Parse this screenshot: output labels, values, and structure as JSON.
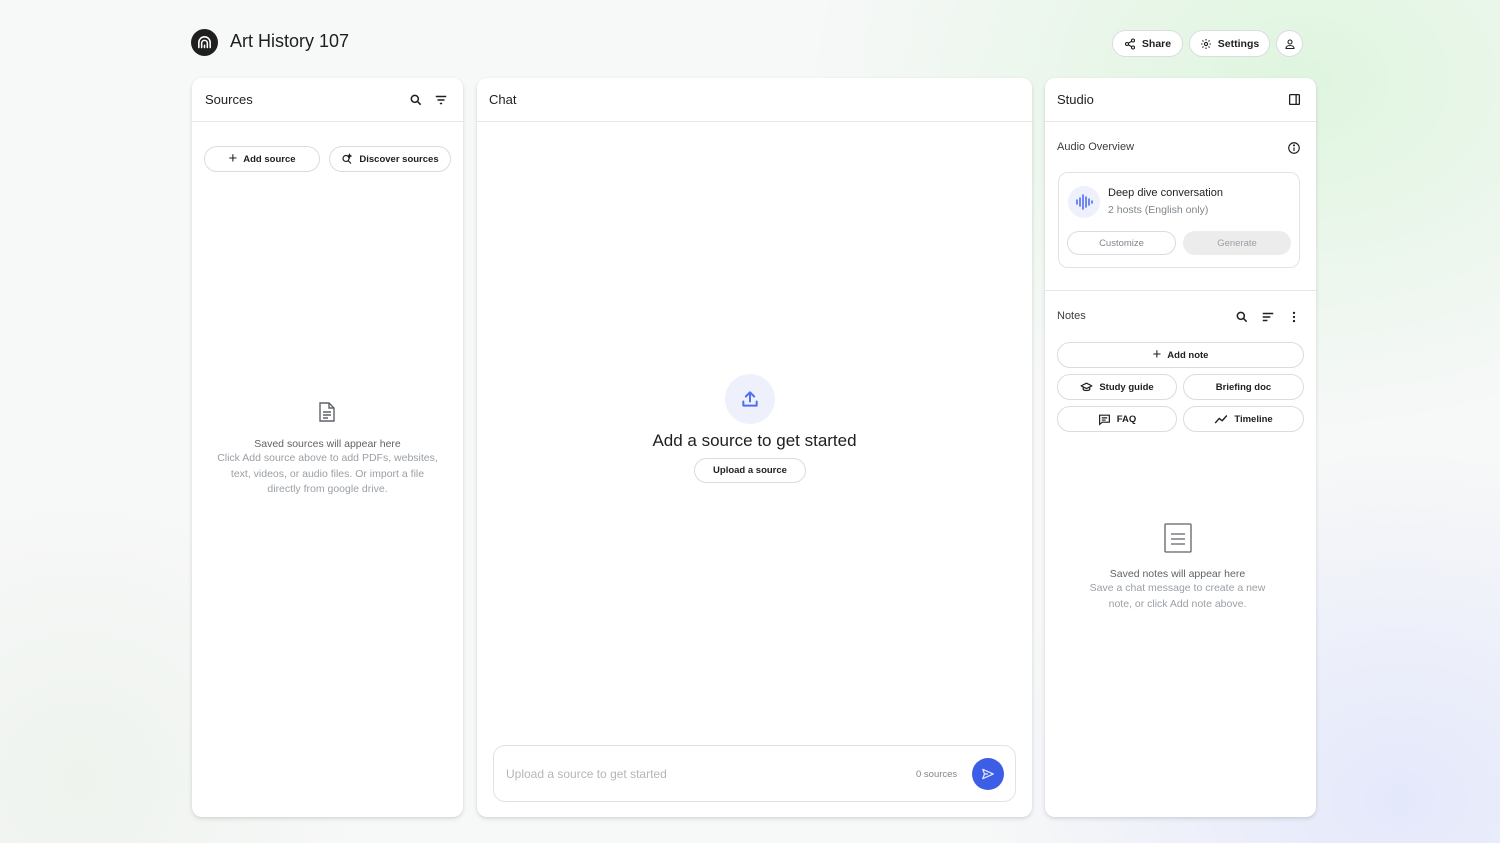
{
  "header": {
    "app_title": "Art History 107",
    "share_label": "Share",
    "settings_label": "Settings"
  },
  "sources": {
    "title": "Sources",
    "add_source_label": "Add source",
    "discover_sources_label": "Discover sources",
    "empty_title": "Saved sources will appear here",
    "empty_line1": "Click Add source above to add PDFs, websites,",
    "empty_line2": "text, videos, or audio files. Or import a file",
    "empty_line3": "directly from google drive."
  },
  "chat": {
    "title": "Chat",
    "cta_heading": "Add a source to get started",
    "upload_button_label": "Upload a source",
    "input_placeholder": "Upload a source to get started",
    "sources_count": "0 sources"
  },
  "studio": {
    "title": "Studio",
    "audio_overview_label": "Audio Overview",
    "audio_card_title": "Deep dive conversation",
    "audio_card_subtitle": "2 hosts (English only)",
    "customize_label": "Customize",
    "generate_label": "Generate",
    "notes_label": "Notes",
    "add_note_label": "Add note",
    "study_guide_label": "Study guide",
    "briefing_doc_label": "Briefing doc",
    "faq_label": "FAQ",
    "timeline_label": "Timeline",
    "notes_empty_title": "Saved notes will appear here",
    "notes_empty_line1": "Save a chat message to create a new",
    "notes_empty_line2": "note, or click Add note above."
  },
  "colors": {
    "accent": "#4f6ef2",
    "send_button": "#3c5de6",
    "disabled_bg": "#ececec",
    "icon_bg": "#eef1fb"
  },
  "icons": {
    "logo": "notebooklm-logo-icon",
    "share": "share-icon",
    "settings": "gear-icon",
    "account": "person-icon",
    "search": "search-icon",
    "filter": "filter-icon",
    "upload": "upload-icon",
    "send": "send-icon"
  }
}
